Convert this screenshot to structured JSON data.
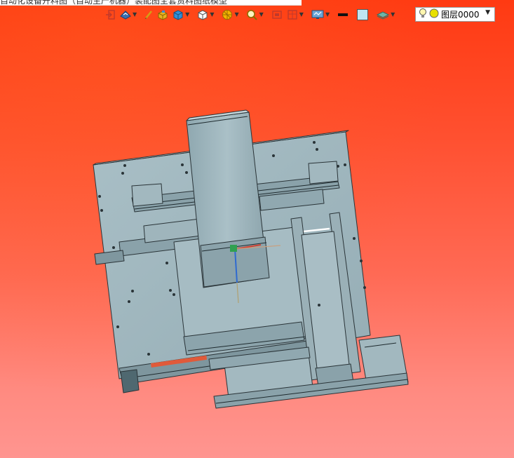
{
  "window": {
    "title": "自动化设备开料图（自动生产机器）装配图全套资料图纸模型"
  },
  "toolbar": {
    "items": [
      {
        "name": "exit-icon",
        "has_caret": false
      },
      {
        "name": "view-orient-icon",
        "has_caret": true
      },
      {
        "name": "pen-icon",
        "has_caret": false
      },
      {
        "name": "solid-box-icon",
        "has_caret": false
      },
      {
        "name": "cube-view-icon",
        "has_caret": true
      },
      {
        "name": "white-cube-icon",
        "has_caret": true
      },
      {
        "name": "render-style-icon",
        "has_caret": true
      },
      {
        "name": "zoom-icon",
        "has_caret": true
      },
      {
        "name": "section-icon",
        "has_caret": false
      },
      {
        "name": "dimension-icon",
        "has_caret": true
      },
      {
        "name": "display-settings-icon",
        "has_caret": true
      },
      {
        "name": "line-color-icon",
        "has_caret": false
      },
      {
        "name": "fill-color-icon",
        "has_caret": false
      },
      {
        "name": "layer-stack-icon",
        "has_caret": true
      }
    ],
    "colors": {
      "line_color": "#111111",
      "fill_color": "#bfe4f2"
    }
  },
  "layer": {
    "current": "图层0000"
  },
  "canvas": {
    "background_top": "#ff3a12",
    "background_bottom": "#ff9590",
    "model_color": "#9fb7bf",
    "edge_color": "#2a3438"
  }
}
